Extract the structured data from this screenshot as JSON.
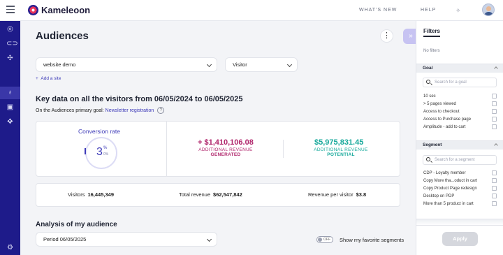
{
  "topbar": {
    "brand": "Kameleoon",
    "nav": [
      "WHAT'S NEW",
      "HELP"
    ]
  },
  "sidebar": {
    "icons": [
      "dashboard-icon",
      "toggle-icon",
      "experiments-icon",
      "lightbulb-icon",
      "image-icon",
      "move-icon",
      "settings-icon"
    ]
  },
  "main": {
    "title": "Audiences",
    "site_select": "website demo",
    "type_select": "Visitor",
    "add_site": "Add a site",
    "key_title": "Key data on all the visitors from 06/05/2024 to 06/05/2025",
    "goal_prefix": "On the Audiences primary goal:",
    "goal_link": "Newsletter registration",
    "conversion": {
      "title": "Conversion rate",
      "value": "3",
      "unit": "%",
      "sub": "0%"
    },
    "revenue_generated": {
      "value": "+ $1,410,106.08",
      "label_top": "ADDITIONAL REVENUE",
      "label_bottom": "GENERATED",
      "color": "#b0256b"
    },
    "revenue_potential": {
      "value": "$5,975,831.45",
      "label_top": "ADDITIONAL REVENUE",
      "label_bottom": "POTENTIAL",
      "color": "#17a99b"
    },
    "stats": {
      "visitors_label": "Visitors",
      "visitors_value": "16,445,349",
      "total_revenue_label": "Total revenue",
      "total_revenue_value": "$62,547,842",
      "rpv_label": "Revenue per visitor",
      "rpv_value": "$3.8"
    },
    "analysis_title": "Analysis of my audience",
    "period_select": "Period 06/05/2025",
    "toggle_state": "OFF",
    "toggle_label": "Show my favorite segments"
  },
  "filters": {
    "title": "Filters",
    "empty": "No filters",
    "goal": {
      "title": "Goal",
      "search_placeholder": "Search for a goal",
      "items": [
        "10 sec",
        "> 5 pages viewed",
        "Access to checkout",
        "Access to Purchase page",
        "Amplitude - add to cart"
      ]
    },
    "segment": {
      "title": "Segment",
      "search_placeholder": "Search for a segment",
      "items": [
        "CDP - Loyalty member",
        "Copy More tha...oduct in cart",
        "Copy Product Page redesign",
        "Desktop on PDP",
        "More than 5 product in cart"
      ]
    },
    "apply": "Apply"
  }
}
